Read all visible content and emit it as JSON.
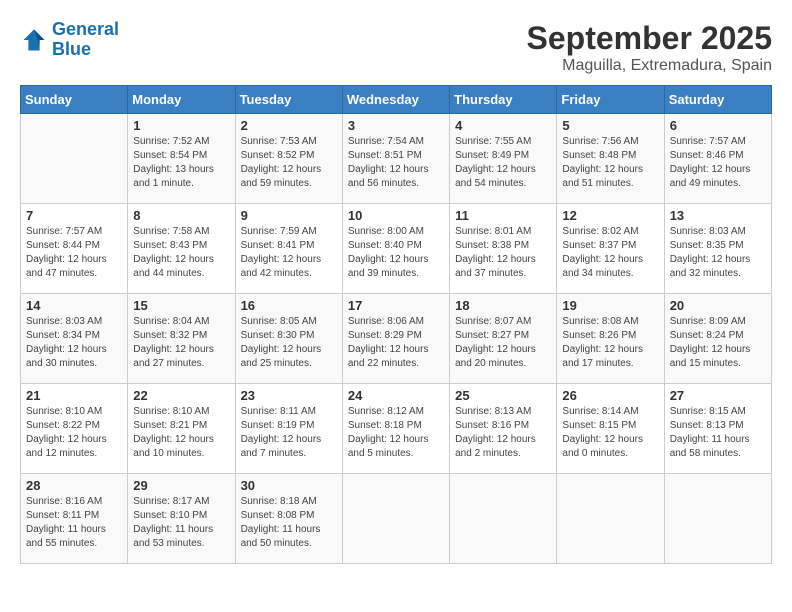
{
  "header": {
    "logo_general": "General",
    "logo_blue": "Blue",
    "month": "September 2025",
    "location": "Maguilla, Extremadura, Spain"
  },
  "days_of_week": [
    "Sunday",
    "Monday",
    "Tuesday",
    "Wednesday",
    "Thursday",
    "Friday",
    "Saturday"
  ],
  "weeks": [
    [
      {
        "day": "",
        "info": ""
      },
      {
        "day": "1",
        "info": "Sunrise: 7:52 AM\nSunset: 8:54 PM\nDaylight: 13 hours and 1 minute."
      },
      {
        "day": "2",
        "info": "Sunrise: 7:53 AM\nSunset: 8:52 PM\nDaylight: 12 hours and 59 minutes."
      },
      {
        "day": "3",
        "info": "Sunrise: 7:54 AM\nSunset: 8:51 PM\nDaylight: 12 hours and 56 minutes."
      },
      {
        "day": "4",
        "info": "Sunrise: 7:55 AM\nSunset: 8:49 PM\nDaylight: 12 hours and 54 minutes."
      },
      {
        "day": "5",
        "info": "Sunrise: 7:56 AM\nSunset: 8:48 PM\nDaylight: 12 hours and 51 minutes."
      },
      {
        "day": "6",
        "info": "Sunrise: 7:57 AM\nSunset: 8:46 PM\nDaylight: 12 hours and 49 minutes."
      }
    ],
    [
      {
        "day": "7",
        "info": "Sunrise: 7:57 AM\nSunset: 8:44 PM\nDaylight: 12 hours and 47 minutes."
      },
      {
        "day": "8",
        "info": "Sunrise: 7:58 AM\nSunset: 8:43 PM\nDaylight: 12 hours and 44 minutes."
      },
      {
        "day": "9",
        "info": "Sunrise: 7:59 AM\nSunset: 8:41 PM\nDaylight: 12 hours and 42 minutes."
      },
      {
        "day": "10",
        "info": "Sunrise: 8:00 AM\nSunset: 8:40 PM\nDaylight: 12 hours and 39 minutes."
      },
      {
        "day": "11",
        "info": "Sunrise: 8:01 AM\nSunset: 8:38 PM\nDaylight: 12 hours and 37 minutes."
      },
      {
        "day": "12",
        "info": "Sunrise: 8:02 AM\nSunset: 8:37 PM\nDaylight: 12 hours and 34 minutes."
      },
      {
        "day": "13",
        "info": "Sunrise: 8:03 AM\nSunset: 8:35 PM\nDaylight: 12 hours and 32 minutes."
      }
    ],
    [
      {
        "day": "14",
        "info": "Sunrise: 8:03 AM\nSunset: 8:34 PM\nDaylight: 12 hours and 30 minutes."
      },
      {
        "day": "15",
        "info": "Sunrise: 8:04 AM\nSunset: 8:32 PM\nDaylight: 12 hours and 27 minutes."
      },
      {
        "day": "16",
        "info": "Sunrise: 8:05 AM\nSunset: 8:30 PM\nDaylight: 12 hours and 25 minutes."
      },
      {
        "day": "17",
        "info": "Sunrise: 8:06 AM\nSunset: 8:29 PM\nDaylight: 12 hours and 22 minutes."
      },
      {
        "day": "18",
        "info": "Sunrise: 8:07 AM\nSunset: 8:27 PM\nDaylight: 12 hours and 20 minutes."
      },
      {
        "day": "19",
        "info": "Sunrise: 8:08 AM\nSunset: 8:26 PM\nDaylight: 12 hours and 17 minutes."
      },
      {
        "day": "20",
        "info": "Sunrise: 8:09 AM\nSunset: 8:24 PM\nDaylight: 12 hours and 15 minutes."
      }
    ],
    [
      {
        "day": "21",
        "info": "Sunrise: 8:10 AM\nSunset: 8:22 PM\nDaylight: 12 hours and 12 minutes."
      },
      {
        "day": "22",
        "info": "Sunrise: 8:10 AM\nSunset: 8:21 PM\nDaylight: 12 hours and 10 minutes."
      },
      {
        "day": "23",
        "info": "Sunrise: 8:11 AM\nSunset: 8:19 PM\nDaylight: 12 hours and 7 minutes."
      },
      {
        "day": "24",
        "info": "Sunrise: 8:12 AM\nSunset: 8:18 PM\nDaylight: 12 hours and 5 minutes."
      },
      {
        "day": "25",
        "info": "Sunrise: 8:13 AM\nSunset: 8:16 PM\nDaylight: 12 hours and 2 minutes."
      },
      {
        "day": "26",
        "info": "Sunrise: 8:14 AM\nSunset: 8:15 PM\nDaylight: 12 hours and 0 minutes."
      },
      {
        "day": "27",
        "info": "Sunrise: 8:15 AM\nSunset: 8:13 PM\nDaylight: 11 hours and 58 minutes."
      }
    ],
    [
      {
        "day": "28",
        "info": "Sunrise: 8:16 AM\nSunset: 8:11 PM\nDaylight: 11 hours and 55 minutes."
      },
      {
        "day": "29",
        "info": "Sunrise: 8:17 AM\nSunset: 8:10 PM\nDaylight: 11 hours and 53 minutes."
      },
      {
        "day": "30",
        "info": "Sunrise: 8:18 AM\nSunset: 8:08 PM\nDaylight: 11 hours and 50 minutes."
      },
      {
        "day": "",
        "info": ""
      },
      {
        "day": "",
        "info": ""
      },
      {
        "day": "",
        "info": ""
      },
      {
        "day": "",
        "info": ""
      }
    ]
  ]
}
